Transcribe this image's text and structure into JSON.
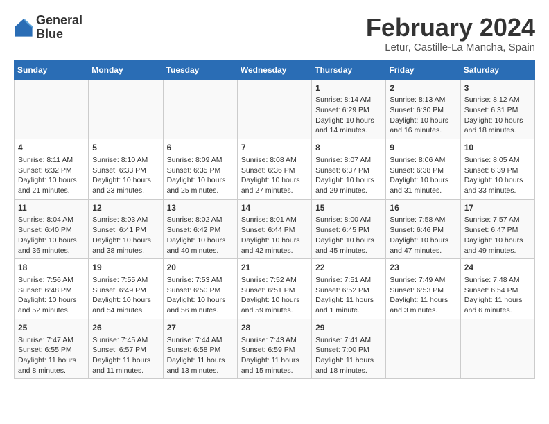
{
  "header": {
    "logo_line1": "General",
    "logo_line2": "Blue",
    "month_title": "February 2024",
    "location": "Letur, Castille-La Mancha, Spain"
  },
  "days_of_week": [
    "Sunday",
    "Monday",
    "Tuesday",
    "Wednesday",
    "Thursday",
    "Friday",
    "Saturday"
  ],
  "weeks": [
    [
      {
        "day": "",
        "content": ""
      },
      {
        "day": "",
        "content": ""
      },
      {
        "day": "",
        "content": ""
      },
      {
        "day": "",
        "content": ""
      },
      {
        "day": "1",
        "content": "Sunrise: 8:14 AM\nSunset: 6:29 PM\nDaylight: 10 hours\nand 14 minutes."
      },
      {
        "day": "2",
        "content": "Sunrise: 8:13 AM\nSunset: 6:30 PM\nDaylight: 10 hours\nand 16 minutes."
      },
      {
        "day": "3",
        "content": "Sunrise: 8:12 AM\nSunset: 6:31 PM\nDaylight: 10 hours\nand 18 minutes."
      }
    ],
    [
      {
        "day": "4",
        "content": "Sunrise: 8:11 AM\nSunset: 6:32 PM\nDaylight: 10 hours\nand 21 minutes."
      },
      {
        "day": "5",
        "content": "Sunrise: 8:10 AM\nSunset: 6:33 PM\nDaylight: 10 hours\nand 23 minutes."
      },
      {
        "day": "6",
        "content": "Sunrise: 8:09 AM\nSunset: 6:35 PM\nDaylight: 10 hours\nand 25 minutes."
      },
      {
        "day": "7",
        "content": "Sunrise: 8:08 AM\nSunset: 6:36 PM\nDaylight: 10 hours\nand 27 minutes."
      },
      {
        "day": "8",
        "content": "Sunrise: 8:07 AM\nSunset: 6:37 PM\nDaylight: 10 hours\nand 29 minutes."
      },
      {
        "day": "9",
        "content": "Sunrise: 8:06 AM\nSunset: 6:38 PM\nDaylight: 10 hours\nand 31 minutes."
      },
      {
        "day": "10",
        "content": "Sunrise: 8:05 AM\nSunset: 6:39 PM\nDaylight: 10 hours\nand 33 minutes."
      }
    ],
    [
      {
        "day": "11",
        "content": "Sunrise: 8:04 AM\nSunset: 6:40 PM\nDaylight: 10 hours\nand 36 minutes."
      },
      {
        "day": "12",
        "content": "Sunrise: 8:03 AM\nSunset: 6:41 PM\nDaylight: 10 hours\nand 38 minutes."
      },
      {
        "day": "13",
        "content": "Sunrise: 8:02 AM\nSunset: 6:42 PM\nDaylight: 10 hours\nand 40 minutes."
      },
      {
        "day": "14",
        "content": "Sunrise: 8:01 AM\nSunset: 6:44 PM\nDaylight: 10 hours\nand 42 minutes."
      },
      {
        "day": "15",
        "content": "Sunrise: 8:00 AM\nSunset: 6:45 PM\nDaylight: 10 hours\nand 45 minutes."
      },
      {
        "day": "16",
        "content": "Sunrise: 7:58 AM\nSunset: 6:46 PM\nDaylight: 10 hours\nand 47 minutes."
      },
      {
        "day": "17",
        "content": "Sunrise: 7:57 AM\nSunset: 6:47 PM\nDaylight: 10 hours\nand 49 minutes."
      }
    ],
    [
      {
        "day": "18",
        "content": "Sunrise: 7:56 AM\nSunset: 6:48 PM\nDaylight: 10 hours\nand 52 minutes."
      },
      {
        "day": "19",
        "content": "Sunrise: 7:55 AM\nSunset: 6:49 PM\nDaylight: 10 hours\nand 54 minutes."
      },
      {
        "day": "20",
        "content": "Sunrise: 7:53 AM\nSunset: 6:50 PM\nDaylight: 10 hours\nand 56 minutes."
      },
      {
        "day": "21",
        "content": "Sunrise: 7:52 AM\nSunset: 6:51 PM\nDaylight: 10 hours\nand 59 minutes."
      },
      {
        "day": "22",
        "content": "Sunrise: 7:51 AM\nSunset: 6:52 PM\nDaylight: 11 hours\nand 1 minute."
      },
      {
        "day": "23",
        "content": "Sunrise: 7:49 AM\nSunset: 6:53 PM\nDaylight: 11 hours\nand 3 minutes."
      },
      {
        "day": "24",
        "content": "Sunrise: 7:48 AM\nSunset: 6:54 PM\nDaylight: 11 hours\nand 6 minutes."
      }
    ],
    [
      {
        "day": "25",
        "content": "Sunrise: 7:47 AM\nSunset: 6:55 PM\nDaylight: 11 hours\nand 8 minutes."
      },
      {
        "day": "26",
        "content": "Sunrise: 7:45 AM\nSunset: 6:57 PM\nDaylight: 11 hours\nand 11 minutes."
      },
      {
        "day": "27",
        "content": "Sunrise: 7:44 AM\nSunset: 6:58 PM\nDaylight: 11 hours\nand 13 minutes."
      },
      {
        "day": "28",
        "content": "Sunrise: 7:43 AM\nSunset: 6:59 PM\nDaylight: 11 hours\nand 15 minutes."
      },
      {
        "day": "29",
        "content": "Sunrise: 7:41 AM\nSunset: 7:00 PM\nDaylight: 11 hours\nand 18 minutes."
      },
      {
        "day": "",
        "content": ""
      },
      {
        "day": "",
        "content": ""
      }
    ]
  ]
}
